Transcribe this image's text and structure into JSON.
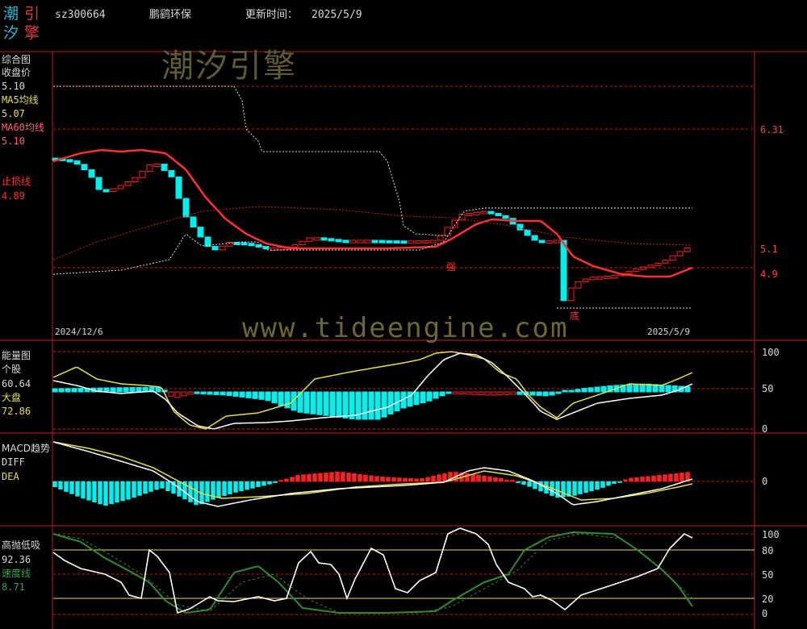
{
  "header": {
    "logo": {
      "c1": "潮",
      "c2": "引",
      "c3": "汐",
      "c4": "擎"
    },
    "code": "sz300664",
    "name": "鹏鹞环保",
    "update_label": "更新时间：",
    "update_date": "2025/5/9"
  },
  "watermark": {
    "cn": "潮汐引擎",
    "url": "www.tideengine.com"
  },
  "colors": {
    "background": "#000000",
    "frame": "#c81e1e",
    "up": "#ff2020",
    "down": "#00f0f0",
    "ma5": "#ffff40",
    "ma60": "#ff5050",
    "stop": "#ff3030",
    "white": "#ffffff",
    "green": "#2e8b2e"
  },
  "price_panel": {
    "title": "综合图",
    "close_label": "收盘价",
    "close_value": "5.10",
    "ma5_label": "MA5均线",
    "ma5_value": "5.07",
    "ma60_label": "MA60均线",
    "ma60_value": "5.10",
    "stop_label": "止损线",
    "stop_value": "4.89",
    "axis_labels": [
      "6.31",
      "5.1",
      "4.9"
    ],
    "date_start": "2024/12/6",
    "date_end": "2025/5/9",
    "annotations": {
      "strong": "强",
      "bottom": "底"
    }
  },
  "energy_panel": {
    "title": "能量图",
    "stock_label": "个股",
    "stock_value": "60.64",
    "market_label": "大盘",
    "market_value": "72.86",
    "axis_labels": [
      "100",
      "50",
      "0"
    ]
  },
  "macd_panel": {
    "title": "MACD趋势",
    "diff_label": "DIFF",
    "dea_label": "DEA",
    "axis_labels": [
      "0"
    ]
  },
  "kdj_panel": {
    "title": "高抛低吸",
    "value": "92.36",
    "speed_label": "速度线",
    "speed_value": "8.71",
    "axis_labels": [
      "100",
      "80",
      "50",
      "20",
      "0"
    ]
  }
}
